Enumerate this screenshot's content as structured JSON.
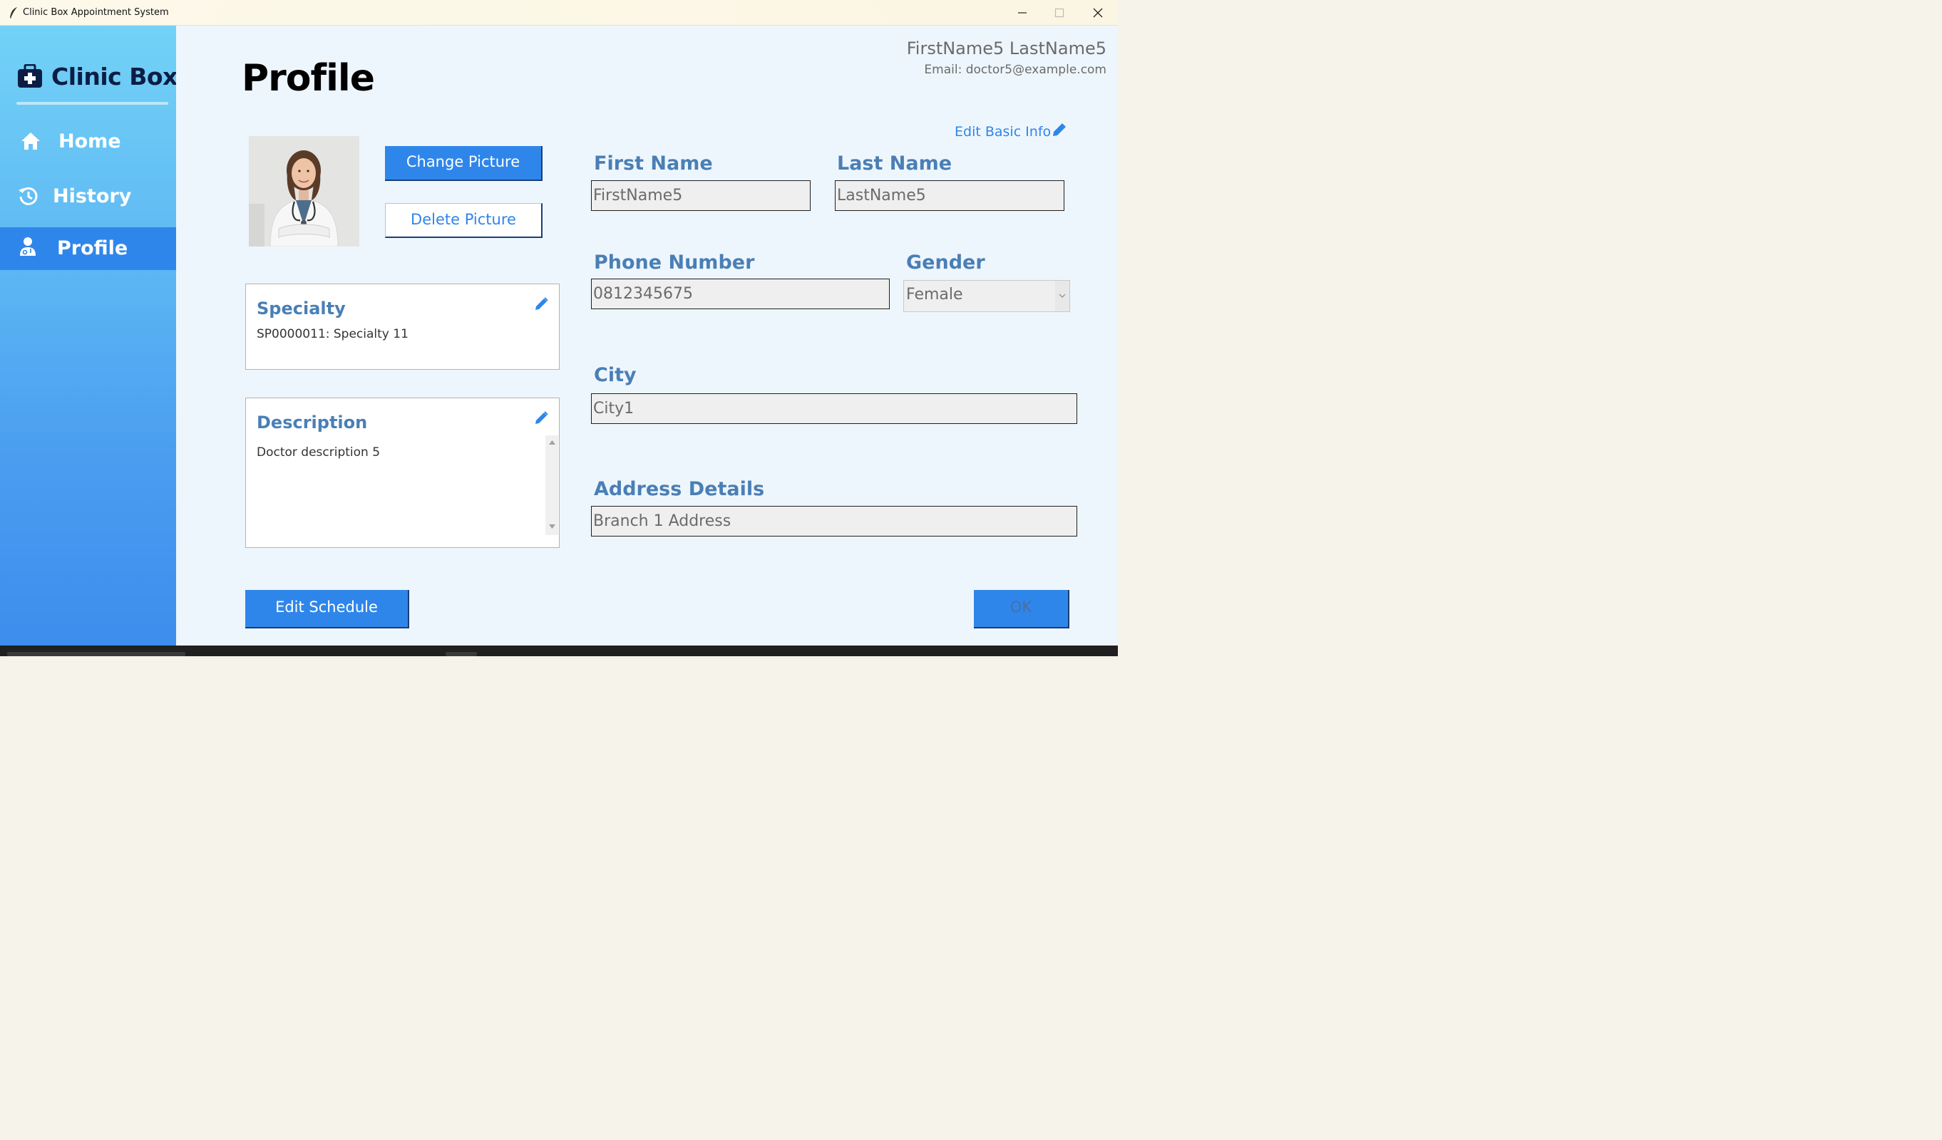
{
  "window": {
    "title": "Clinic Box Appointment System",
    "controls": [
      "minimize",
      "maximize",
      "close"
    ]
  },
  "sidebar": {
    "brand": "Clinic Box",
    "brand_icon": "medical-kit-icon",
    "items": [
      {
        "label": "Home",
        "icon": "home-icon",
        "active": false
      },
      {
        "label": "History",
        "icon": "history-icon",
        "active": false
      },
      {
        "label": "Profile",
        "icon": "doctor-icon",
        "active": true
      }
    ]
  },
  "header": {
    "title": "Profile",
    "user_name": "FirstName5 LastName5",
    "user_email": "Email: doctor5@example.com"
  },
  "picture": {
    "change_label": "Change Picture",
    "delete_label": "Delete Picture"
  },
  "specialty": {
    "title": "Specialty",
    "value": "SP0000011: Specialty 11"
  },
  "description": {
    "title": "Description",
    "value": "Doctor description 5"
  },
  "basic_info": {
    "edit_label": "Edit Basic Info",
    "first_name": {
      "label": "First Name",
      "value": "FirstName5"
    },
    "last_name": {
      "label": "Last Name",
      "value": "LastName5"
    },
    "phone": {
      "label": "Phone Number",
      "value": "0812345675"
    },
    "gender": {
      "label": "Gender",
      "value": "Female"
    },
    "city": {
      "label": "City",
      "value": "City1"
    },
    "address": {
      "label": "Address Details",
      "value": "Branch 1 Address"
    }
  },
  "actions": {
    "edit_schedule_label": "Edit Schedule",
    "ok_label": "OK"
  },
  "colors": {
    "accent": "#2f86ea",
    "label_blue": "#4a7fb5",
    "sidebar_top": "#73d2f6",
    "sidebar_bottom": "#3d8ded",
    "main_bg": "#eef6fd"
  }
}
